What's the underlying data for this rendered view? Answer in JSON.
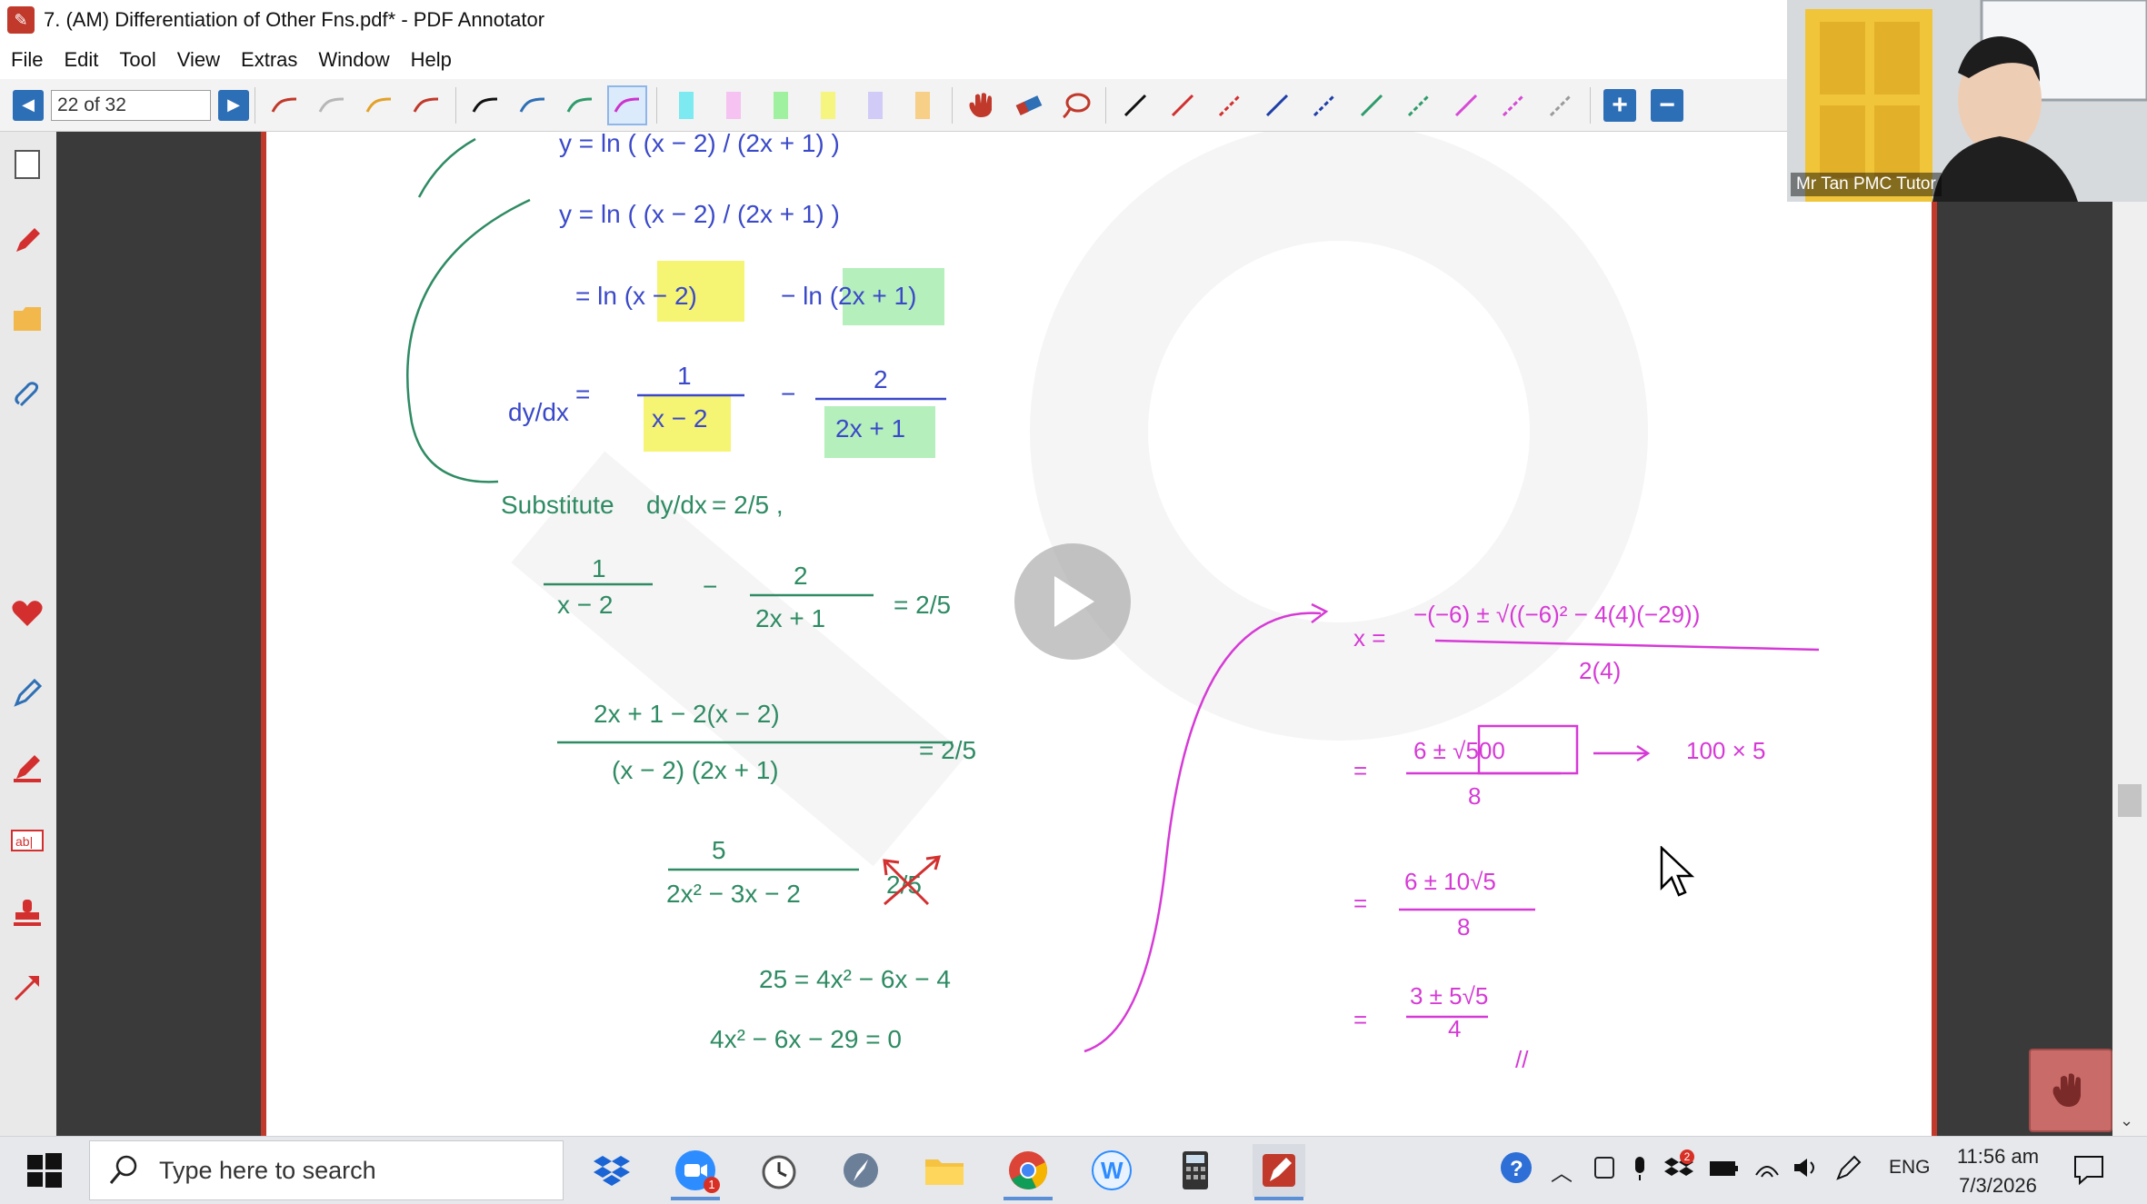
{
  "window": {
    "title": "7. (AM) Differentiation of Other Fns.pdf* - PDF Annotator"
  },
  "menu": [
    "File",
    "Edit",
    "Tool",
    "View",
    "Extras",
    "Window",
    "Help"
  ],
  "toolbar": {
    "page_indicator": "22 of 32",
    "pen_colors": [
      "#c0392b",
      "#b7b7b7",
      "#e2a12a",
      "#c0392b",
      "#111111",
      "#2e6fb5",
      "#2e9b6a",
      "#cc33cc"
    ],
    "highlighter_colors": [
      "#67e6f0",
      "#f5b8f0",
      "#8ff08f",
      "#f5f56a",
      "#c9c3f7",
      "#f7c873"
    ],
    "line_colors": [
      "#111111",
      "#d32f2f",
      "#d32f2f",
      "#1e3fa8",
      "#1e3fa8",
      "#2e9b6a",
      "#2e9b6a",
      "#d64ad6",
      "#d64ad6",
      "#9a9a9a"
    ]
  },
  "webcam": {
    "name_label": "Mr Tan PMC Tutor"
  },
  "handwriting": {
    "blue": {
      "line1": "y = ln ( (x − 2) / (2x + 1) )",
      "line2": "y = ln ( (x − 2) / (2x + 1) )",
      "line3_a": "= ln (x − 2)",
      "line3_b": "− ln (2x + 1)",
      "dydx": "dy/dx",
      "eq": "=",
      "frac1_num": "1",
      "frac1_den": "x − 2",
      "minus": "−",
      "frac2_num": "2",
      "frac2_den": "2x + 1"
    },
    "green": {
      "substitute": "Substitute",
      "sub_dydx": "dy/dx",
      "sub_val": "= 2/5 ,",
      "eq1_f1_num": "1",
      "eq1_f1_den": "x − 2",
      "eq1_minus": "−",
      "eq1_f2_num": "2",
      "eq1_f2_den": "2x + 1",
      "eq1_rhs": "= 2/5",
      "eq2_num": "2x + 1 − 2(x − 2)",
      "eq2_den": "(x − 2) (2x + 1)",
      "eq2_rhs": "= 2/5",
      "eq3_num": "5",
      "eq3_den": "2x² − 3x − 2",
      "eq3_rhs": "2/5",
      "eq4": "25 = 4x² − 6x − 4",
      "eq5": "4x² − 6x − 29 = 0"
    },
    "magenta": {
      "x_eq": "x =",
      "quad_num": "−(−6) ± √((−6)² − 4(4)(−29))",
      "quad_den": "2(4)",
      "s1_eq": "=",
      "s1_num": "6 ± √500",
      "s1_den": "8",
      "s1_note": "100 × 5",
      "s2_eq": "=",
      "s2_num": "6 ± 10√5",
      "s2_den": "8",
      "s3_eq": "=",
      "s3_num": "3 ± 5√5",
      "s3_den": "4",
      "done_mark": "//"
    }
  },
  "taskbar": {
    "search_placeholder": "Type here to search",
    "language": "ENG",
    "time": "11:56 am",
    "date": "7/3/2026",
    "zoom_badge": "1",
    "pdf_badge": "2"
  }
}
